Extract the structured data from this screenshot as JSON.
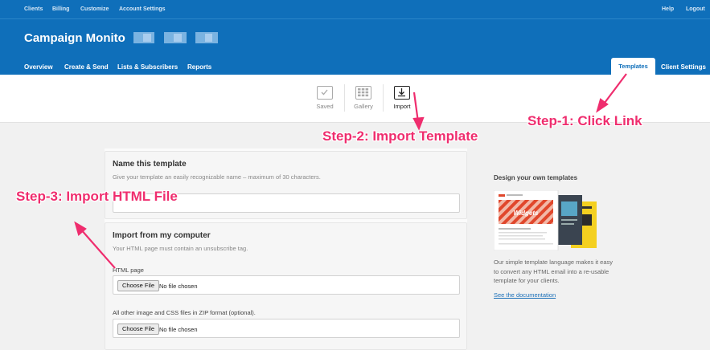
{
  "topbar": {
    "links": [
      "Clients",
      "Billing",
      "Customize",
      "Account Settings"
    ],
    "help": "Help",
    "logout": "Logout"
  },
  "brand": "Campaign Monito",
  "nav": {
    "items": [
      "Overview",
      "Create & Send",
      "Lists & Subscribers",
      "Reports"
    ],
    "tab_active": "Templates",
    "tab_other": "Client Settings"
  },
  "toolbar": {
    "saved": "Saved",
    "gallery": "Gallery",
    "import": "Import"
  },
  "form": {
    "name_title": "Name this template",
    "name_hint": "Give your template an easily recognizable name – maximum of 30 characters.",
    "name_value": "",
    "import_title": "Import from my computer",
    "import_hint": "Your HTML page must contain an unsubscribe tag.",
    "html_label": "HTML page",
    "zip_label": "All other image and CSS files in ZIP format (optional).",
    "choose_file": "Choose File",
    "no_file": "No file chosen"
  },
  "sidebar": {
    "title": "Design your own templates",
    "preview_word": "Widgets",
    "text": "Our simple template language makes it easy to convert any HTML email into a re-usable template for your clients.",
    "link": "See the documentation"
  },
  "annotations": {
    "step1": "Step-1: Click Link",
    "step2": "Step-2: Import Template",
    "step3": "Step-3: Import HTML File",
    "color": "#ef2d6e"
  },
  "colors": {
    "header": "#0f6fba",
    "link": "#1a6fb8"
  }
}
